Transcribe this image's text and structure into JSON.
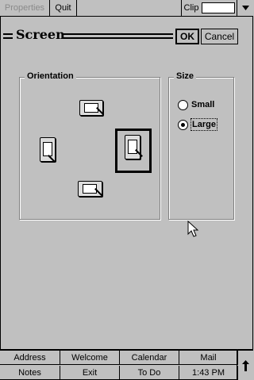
{
  "menubar": {
    "properties_label": "Properties",
    "quit_label": "Quit",
    "clip_label": "Clip"
  },
  "dialog": {
    "title": "Screen",
    "ok_label": "OK",
    "cancel_label": "Cancel"
  },
  "orientation": {
    "label": "Orientation",
    "options": [
      "up",
      "left",
      "right",
      "down"
    ],
    "selected": "right"
  },
  "size": {
    "label": "Size",
    "options": [
      {
        "label": "Small",
        "checked": false
      },
      {
        "label": "Large",
        "checked": true
      }
    ]
  },
  "taskbar": {
    "row1": [
      "Address",
      "Welcome",
      "Calendar",
      "Mail"
    ],
    "row2": [
      "Notes",
      "Exit",
      "To Do"
    ],
    "clock": "1:43 PM",
    "scroll_icon": "up-arrow-icon"
  }
}
